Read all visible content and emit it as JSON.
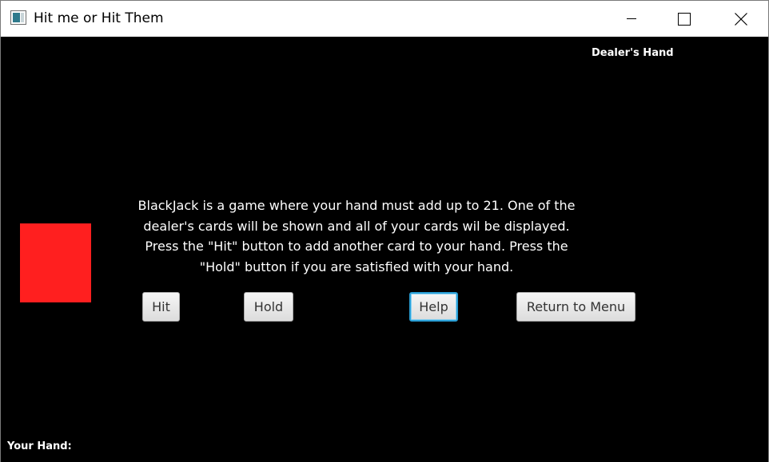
{
  "window": {
    "title": "Hit me or Hit Them",
    "icon": "java-app-icon",
    "controls": {
      "minimize": "minimize-icon",
      "maximize": "maximize-icon",
      "close": "close-icon"
    }
  },
  "game": {
    "dealer_label": "Dealer's Hand",
    "player_label": "Your Hand:",
    "instructions": "BlackJack is a game where your hand must add up to 21. One of the dealer's cards will be shown and all of your cards wil be displayed. Press the \"Hit\" button to add another card to your hand. Press the \"Hold\" button if you are satisfied with your hand.",
    "card_color": "#ff1f1f",
    "background_color": "#000000"
  },
  "buttons": {
    "hit": "Hit",
    "hold": "Hold",
    "help": "Help",
    "return_menu": "Return to Menu"
  }
}
